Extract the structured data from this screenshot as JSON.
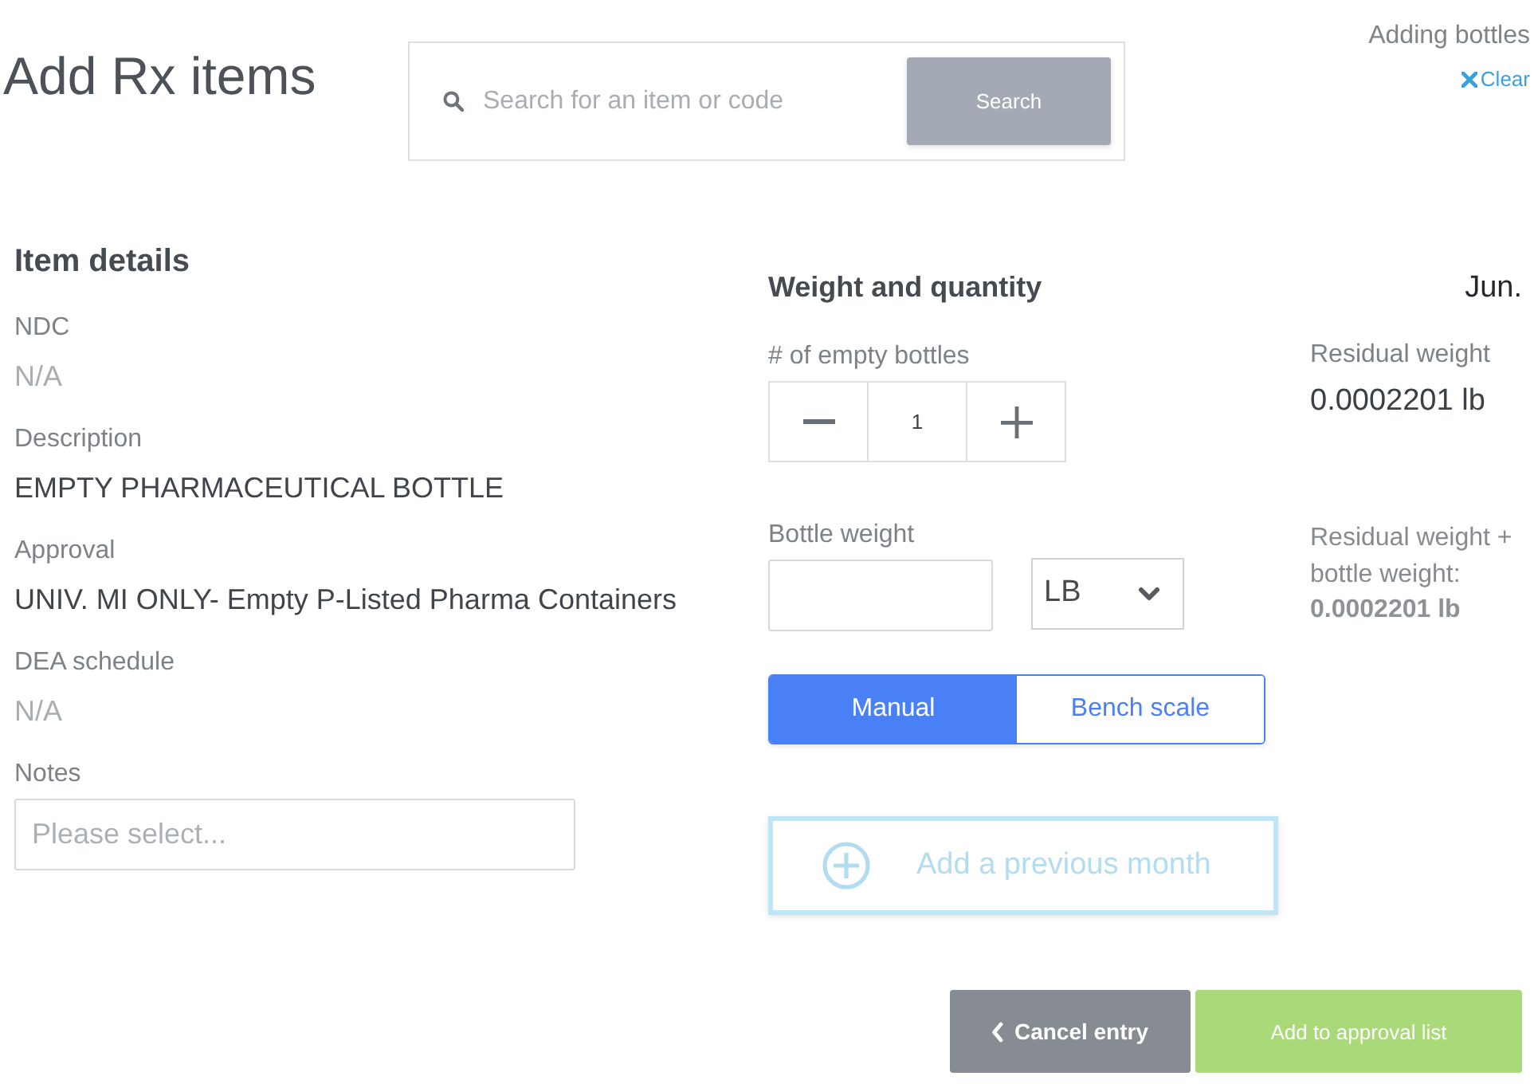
{
  "header": {
    "title": "Add Rx items",
    "search": {
      "placeholder": "Search for an item or code",
      "button": {
        "label": "Search",
        "disabled": true
      }
    },
    "context": {
      "label": "Adding bottles",
      "clear": "Clear"
    }
  },
  "item_details": {
    "heading": "Item details",
    "fields": [
      {
        "label": "NDC",
        "value": "N/A",
        "missing": true
      },
      {
        "label": "Description",
        "value": "EMPTY PHARMACEUTICAL BOTTLE",
        "missing": false
      },
      {
        "label": "Approval",
        "value": "UNIV. MI ONLY- Empty P-Listed Pharma Containers",
        "missing": false
      },
      {
        "label": "DEA schedule",
        "value": "N/A",
        "missing": true
      }
    ],
    "notes": {
      "label": "Notes",
      "placeholder": "Please select..."
    }
  },
  "weight_quantity": {
    "heading": "Weight and quantity",
    "bottles": {
      "label": "# of empty bottles",
      "value": "1"
    },
    "bottle_weight": {
      "label": "Bottle weight",
      "unit": "LB"
    },
    "mode_toggle": [
      {
        "label": "Manual",
        "selected": true
      },
      {
        "label": "Bench scale",
        "selected": false
      }
    ],
    "add_previous_month": {
      "label": "Add a previous month",
      "disabled": true
    }
  },
  "summary": {
    "month": "Jun.",
    "residual": {
      "label": "Residual weight",
      "value": "0.0002201 lb"
    },
    "total": {
      "label": "Residual weight + bottle weight:",
      "value": "0.0002201 lb"
    }
  },
  "actions": [
    {
      "kind": "cancel",
      "label": "Cancel entry",
      "disabled": false
    },
    {
      "kind": "submit",
      "label": "Add to approval list",
      "disabled": true
    }
  ]
}
